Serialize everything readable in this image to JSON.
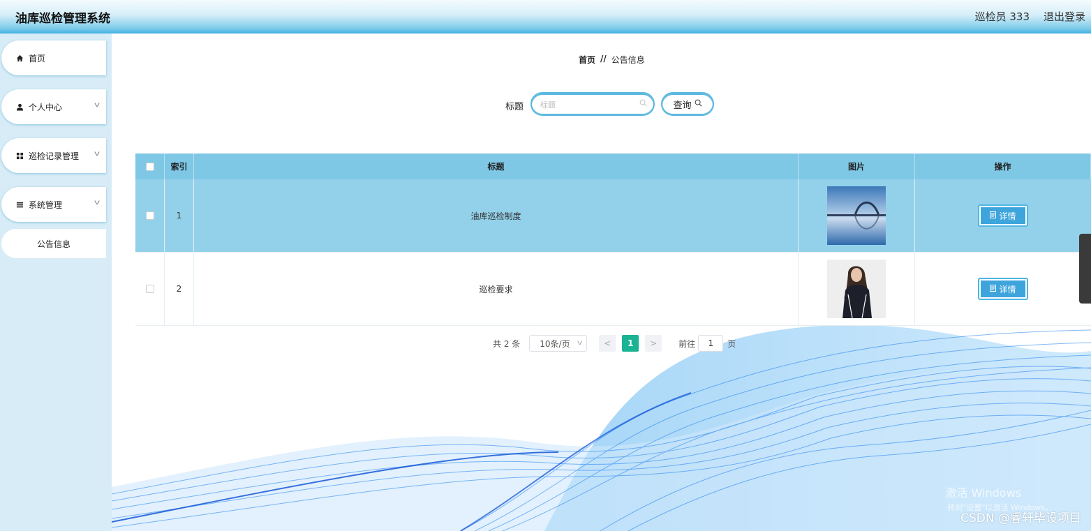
{
  "header": {
    "app_title": "油库巡检管理系统",
    "user_label": "巡检员 333",
    "logout_label": "退出登录"
  },
  "sidebar": {
    "items": [
      {
        "label": "首页",
        "icon": "home-icon"
      },
      {
        "label": "个人中心",
        "icon": "user-icon",
        "expandable": true
      },
      {
        "label": "巡检记录管理",
        "icon": "grid-icon",
        "expandable": true
      },
      {
        "label": "系统管理",
        "icon": "list-icon",
        "expandable": true
      }
    ],
    "sub_item": {
      "label": "公告信息"
    }
  },
  "breadcrumb": {
    "home": "首页",
    "separator": "//",
    "current": "公告信息"
  },
  "search": {
    "label": "标题",
    "placeholder": "标题",
    "value": "",
    "button_label": "查询"
  },
  "table": {
    "headers": {
      "index": "索引",
      "title": "标题",
      "image": "图片",
      "action": "操作"
    },
    "rows": [
      {
        "index": "1",
        "title": "油库巡检制度",
        "image": "bridge-photo",
        "action_label": "详情",
        "highlighted": true
      },
      {
        "index": "2",
        "title": "巡检要求",
        "image": "woman-photo",
        "action_label": "详情",
        "highlighted": false
      }
    ]
  },
  "pagination": {
    "total": "共 2 条",
    "page_size": "10条/页",
    "current_page": "1",
    "goto_label": "前往",
    "goto_value": "1",
    "page_unit": "页"
  },
  "overlay": {
    "windows_line1": "激活 Windows",
    "windows_line2": "转到\"设置\"以激活 Windows。",
    "csdn": "CSDN @睿轩毕设项目"
  },
  "colors": {
    "accent": "#3ea4dc",
    "header_blue": "#7ec8e6",
    "row_highlight": "#93d1ea",
    "page_active": "#1ab394"
  }
}
